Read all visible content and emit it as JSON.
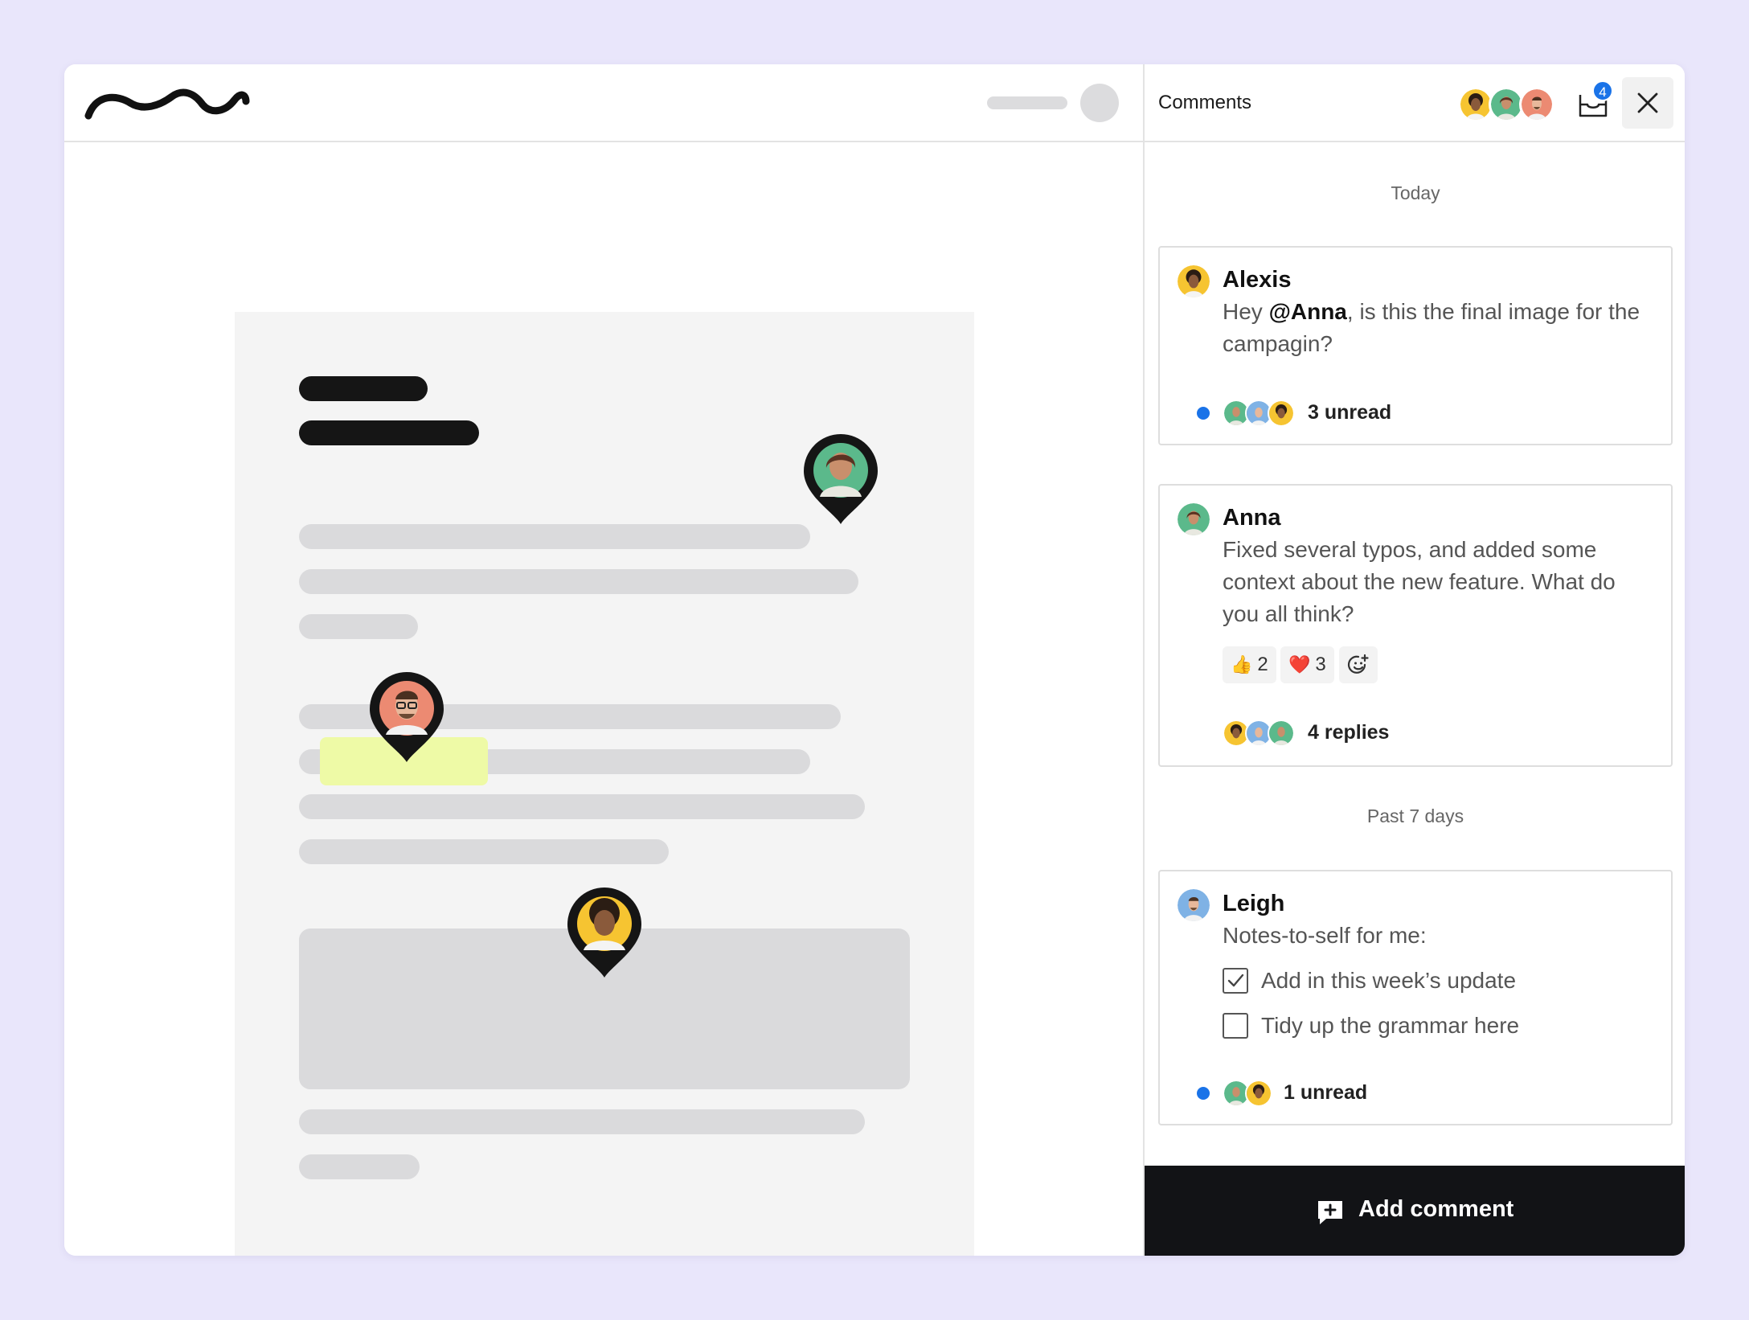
{
  "panel": {
    "title": "Comments",
    "inbox_count": "4",
    "header_avatars": [
      "avatar-alexis",
      "avatar-anna",
      "avatar-leigh"
    ]
  },
  "sections": [
    {
      "label": "Today"
    },
    {
      "label": "Past 7 days"
    }
  ],
  "comments": [
    {
      "author": "Alexis",
      "text_before": "Hey ",
      "mention": "@Anna",
      "text_after": ", is this the final image for the campagin?",
      "status": "3 unread"
    },
    {
      "author": "Anna",
      "text": "Fixed several typos, and added some context about the new feature. What do you all think?",
      "reactions": [
        {
          "emoji": "👍",
          "count": "2"
        },
        {
          "emoji": "❤️",
          "count": "3"
        }
      ],
      "status": "4 replies"
    },
    {
      "author": "Leigh",
      "text": "Notes-to-self for me:",
      "checklist": [
        {
          "label": "Add in this week’s update",
          "checked": true
        },
        {
          "label": "Tidy up the grammar here",
          "checked": false
        }
      ],
      "status": "1 unread"
    }
  ],
  "footer": {
    "add_comment_label": "Add comment"
  },
  "colors": {
    "background": "#e9e6fb",
    "accent_blue": "#1a73e8",
    "highlight": "#eefaa6",
    "footer_bg": "#121316",
    "avatar_yellow": "#f6c431",
    "avatar_green": "#5bb98b",
    "avatar_salmon": "#ec8a72",
    "avatar_blue": "#7fb2e5"
  }
}
